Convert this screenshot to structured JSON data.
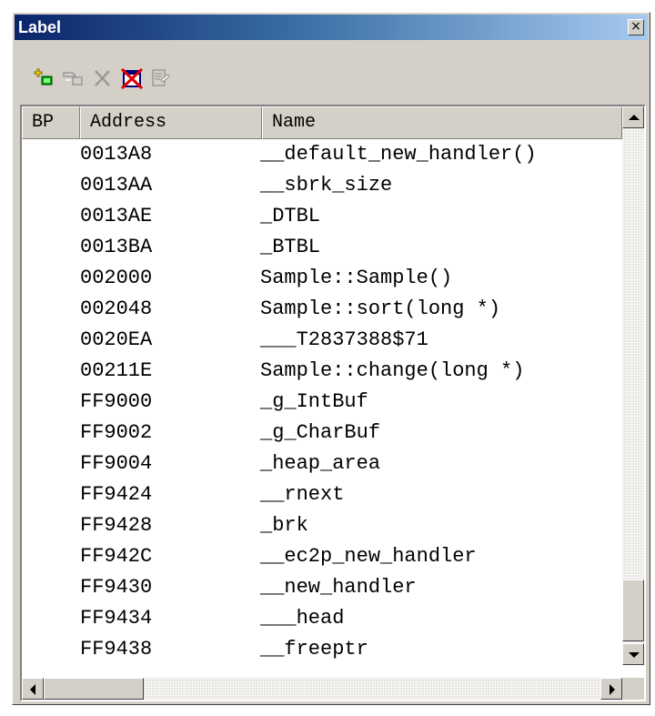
{
  "window": {
    "title": "Label",
    "close_glyph": "×"
  },
  "toolbar": {
    "buttons": [
      {
        "icon": "add-label-icon",
        "enabled": true
      },
      {
        "icon": "edit-label-icon",
        "enabled": false
      },
      {
        "icon": "delete-label-icon",
        "enabled": false
      },
      {
        "icon": "delete-all-icon",
        "enabled": true
      },
      {
        "icon": "view-source-icon",
        "enabled": false
      }
    ]
  },
  "columns": {
    "bp": "BP",
    "address": "Address",
    "name": "Name"
  },
  "rows": [
    {
      "bp": "",
      "address": "0013A8",
      "name": "__default_new_handler()"
    },
    {
      "bp": "",
      "address": "0013AA",
      "name": "__sbrk_size"
    },
    {
      "bp": "",
      "address": "0013AE",
      "name": "_DTBL"
    },
    {
      "bp": "",
      "address": "0013BA",
      "name": "_BTBL"
    },
    {
      "bp": "",
      "address": "002000",
      "name": "Sample::Sample()"
    },
    {
      "bp": "",
      "address": "002048",
      "name": "Sample::sort(long *)"
    },
    {
      "bp": "",
      "address": "0020EA",
      "name": "___T2837388$71"
    },
    {
      "bp": "",
      "address": "00211E",
      "name": "Sample::change(long *)"
    },
    {
      "bp": "",
      "address": "FF9000",
      "name": "_g_IntBuf"
    },
    {
      "bp": "",
      "address": "FF9002",
      "name": "_g_CharBuf"
    },
    {
      "bp": "",
      "address": "FF9004",
      "name": "_heap_area"
    },
    {
      "bp": "",
      "address": "FF9424",
      "name": "__rnext"
    },
    {
      "bp": "",
      "address": "FF9428",
      "name": "_brk"
    },
    {
      "bp": "",
      "address": "FF942C",
      "name": "__ec2p_new_handler"
    },
    {
      "bp": "",
      "address": "FF9430",
      "name": "__new_handler"
    },
    {
      "bp": "",
      "address": "FF9434",
      "name": "___head"
    },
    {
      "bp": "",
      "address": "FF9438",
      "name": "__freeptr"
    }
  ],
  "colors": {
    "title_start": "#0a246a",
    "title_end": "#a6caf0",
    "face": "#d4d0c8",
    "list_bg": "#ffffff"
  }
}
